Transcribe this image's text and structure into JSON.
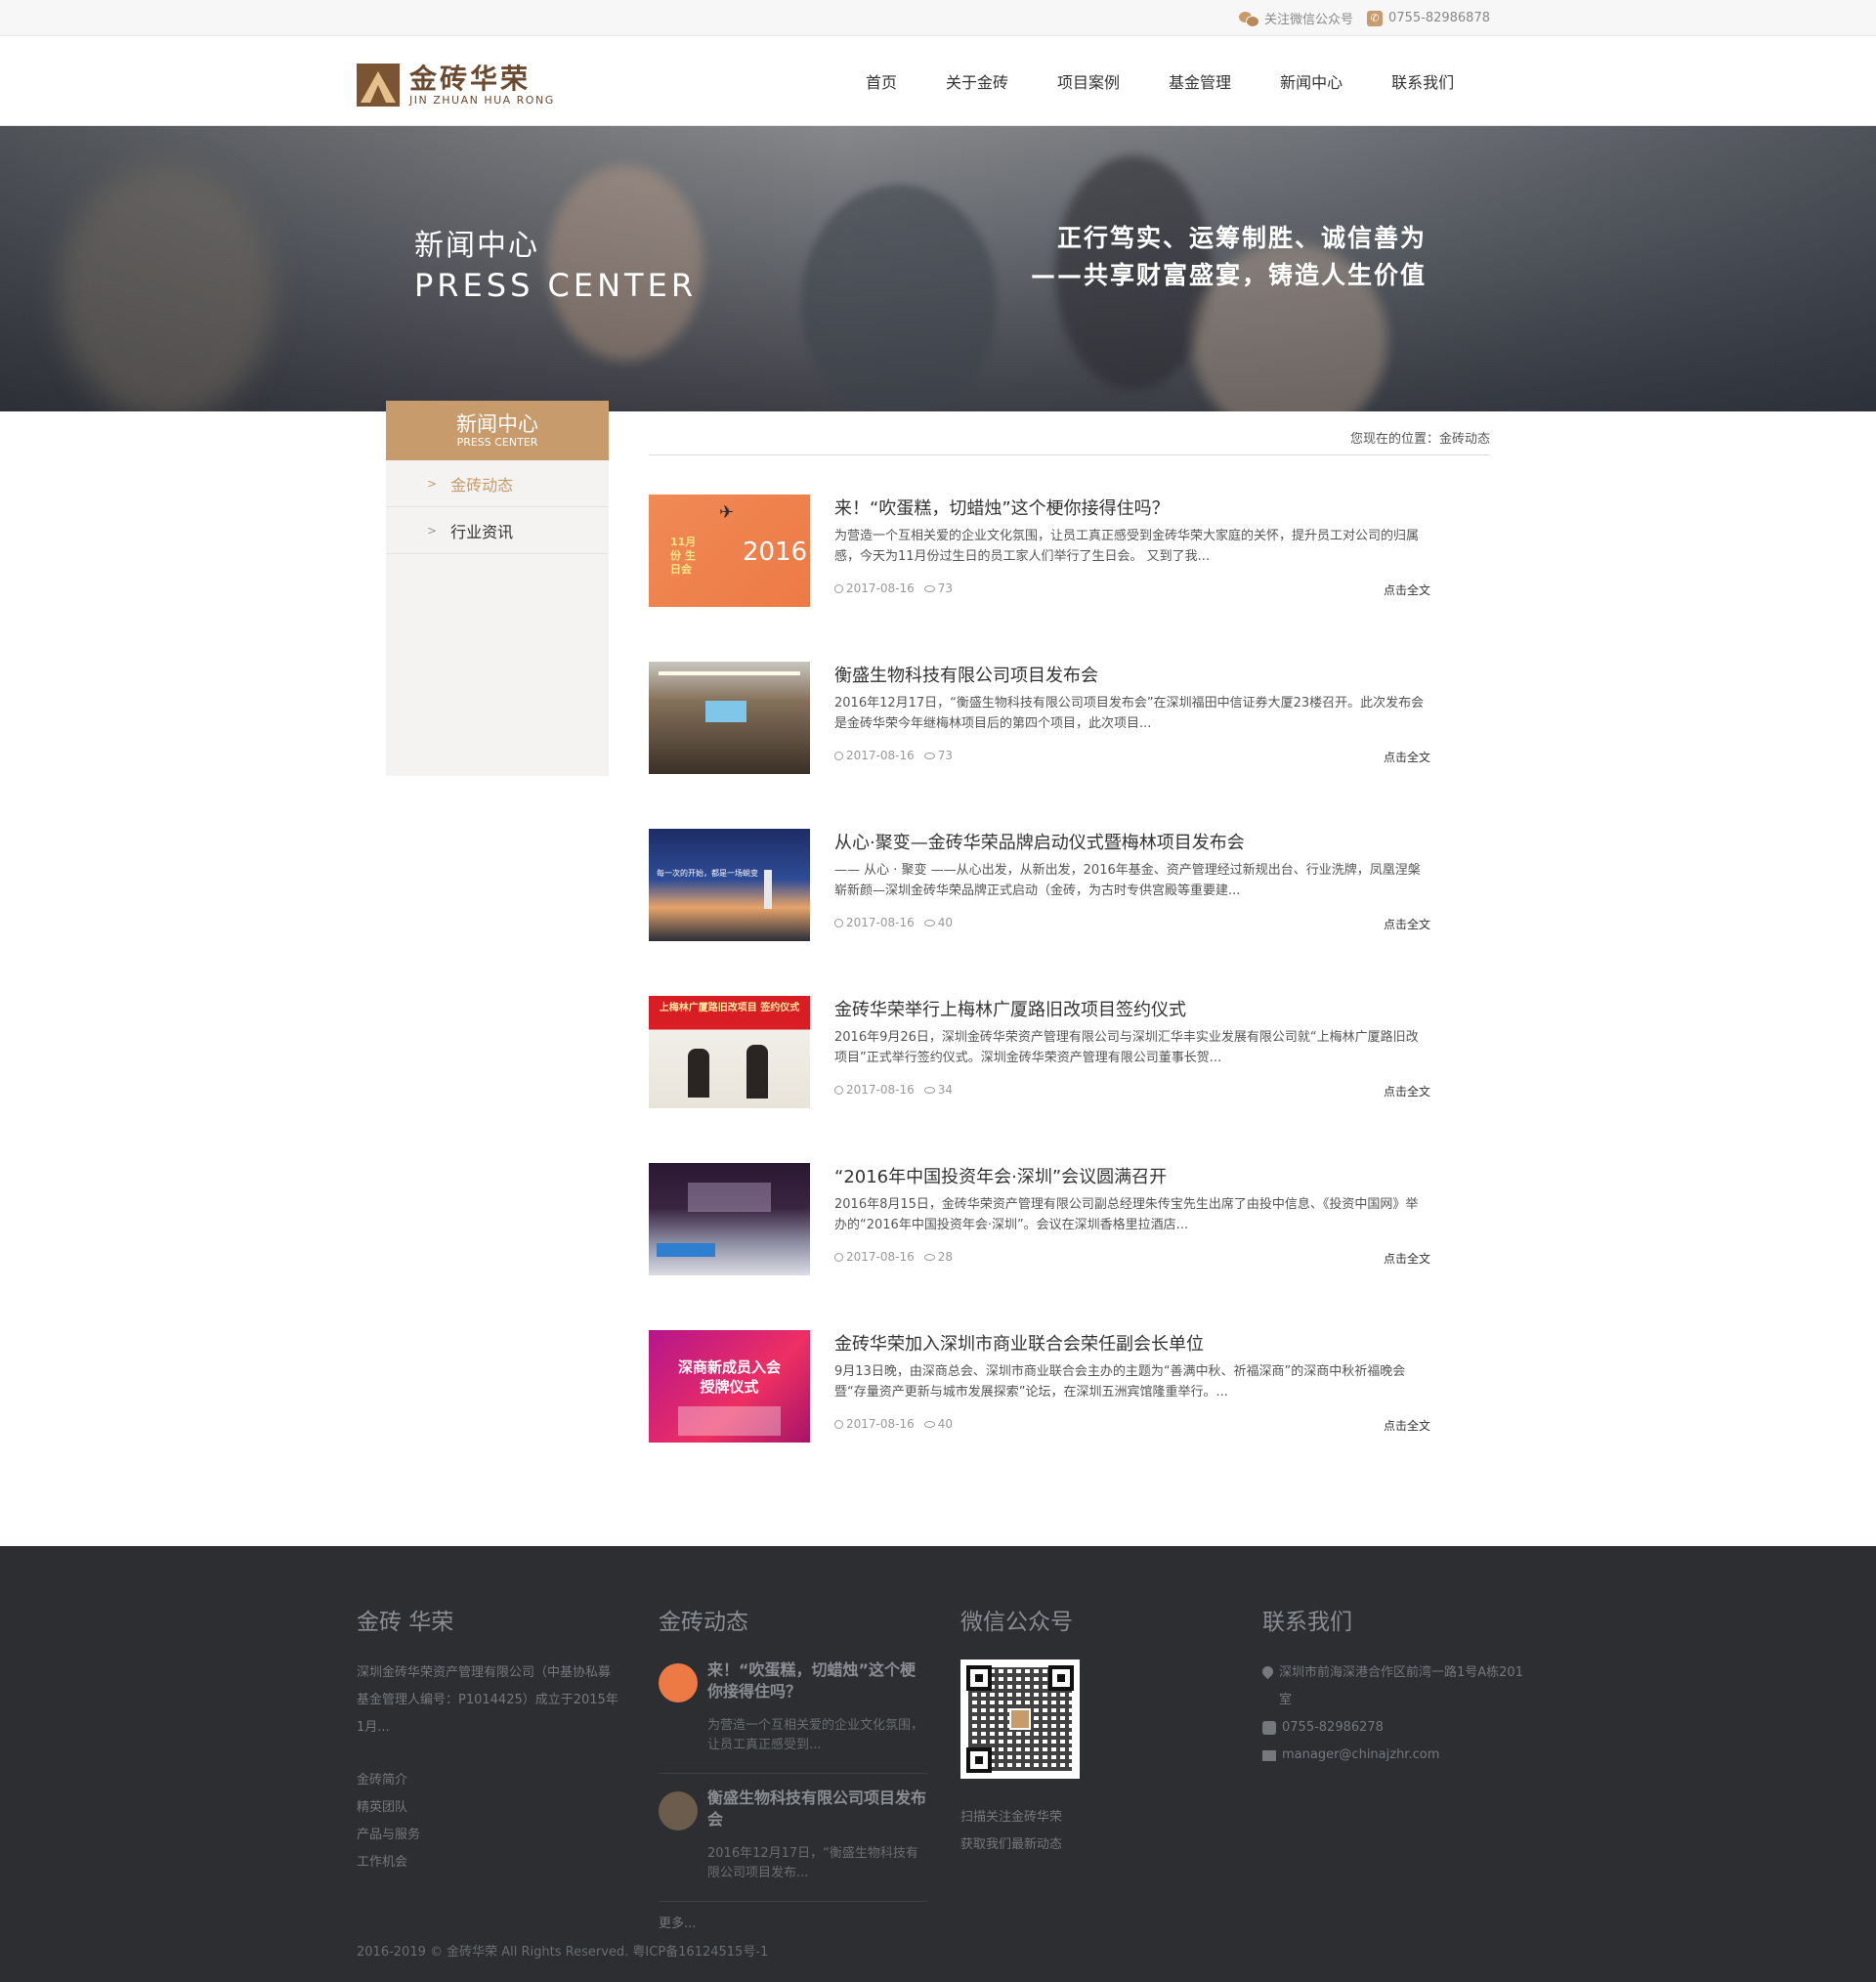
{
  "topbar": {
    "wechat_label": "关注微信公众号",
    "phone": "0755-82986878"
  },
  "logo": {
    "cn": "金砖华荣",
    "en": "JIN ZHUAN HUA RONG"
  },
  "nav": [
    "首页",
    "关于金砖",
    "项目案例",
    "基金管理",
    "新闻中心",
    "联系我们"
  ],
  "banner": {
    "title_cn": "新闻中心",
    "title_en": "PRESS CENTER",
    "slogan_1": "正行笃实、运筹制胜、诚信善为",
    "slogan_2": "——共享财富盛宴，铸造人生价值"
  },
  "sidebar": {
    "title_cn": "新闻中心",
    "title_en": "PRESS CENTER",
    "items": [
      {
        "label": "金砖动态",
        "active": true
      },
      {
        "label": "行业资讯",
        "active": false
      }
    ]
  },
  "breadcrumb": "您现在的位置：金砖动态",
  "news": [
    {
      "title": "来！“吹蛋糕，切蜡烛”这个梗你接得住吗？",
      "desc": "为营造一个互相关爱的企业文化氛围，让员工真正感受到金砖华荣大家庭的关怀，提升员工对公司的归属感，今天为11月份过生日的员工家人们举行了生日会。 又到了我...",
      "date": "2017-08-16",
      "views": "73",
      "more": "点击全文",
      "thumb_text": "2016",
      "thumb_text_2": "11月份 生日会"
    },
    {
      "title": "衡盛生物科技有限公司项目发布会",
      "desc": "2016年12月17日，“衡盛生物科技有限公司项目发布会”在深圳福田中信证券大厦23楼召开。此次发布会是金砖华荣今年继梅林项目后的第四个项目，此次项目...",
      "date": "2017-08-16",
      "views": "73",
      "more": "点击全文"
    },
    {
      "title": "从心·聚变—金砖华荣品牌启动仪式暨梅林项目发布会",
      "desc": "—— 从心 · 聚变 ——从心出发，从新出发，2016年基金、资产管理经过新规出台、行业洗牌，凤凰涅槃崭新颜—深圳金砖华荣品牌正式启动（金砖，为古时专供宫殿等重要建...",
      "date": "2017-08-16",
      "views": "40",
      "more": "点击全文",
      "thumb_text": "每一次的开始，都是一场蜕变"
    },
    {
      "title": "金砖华荣举行上梅林广厦路旧改项目签约仪式",
      "desc": "2016年9月26日，深圳金砖华荣资产管理有限公司与深圳汇华丰实业发展有限公司就“上梅林广厦路旧改项目”正式举行签约仪式。深圳金砖华荣资产管理有限公司董事长贺...",
      "date": "2017-08-16",
      "views": "34",
      "more": "点击全文",
      "thumb_text": "上梅林广厦路旧改项目 签约仪式"
    },
    {
      "title": "“2016年中国投资年会·深圳”会议圆满召开",
      "desc": "2016年8月15日，金砖华荣资产管理有限公司副总经理朱传宝先生出席了由投中信息、《投资中国网》举办的“2016年中国投资年会·深圳”。会议在深圳香格里拉酒店...",
      "date": "2017-08-16",
      "views": "28",
      "more": "点击全文"
    },
    {
      "title": "金砖华荣加入深圳市商业联合会荣任副会长单位",
      "desc": "9月13日晚，由深商总会、深圳市商业联合会主办的主题为“善满中秋、祈福深商”的深商中秋祈福晚会暨“存量资产更新与城市发展探索”论坛，在深圳五洲宾馆隆重举行。...",
      "date": "2017-08-16",
      "views": "40",
      "more": "点击全文",
      "thumb_text": "深商新成员入会 授牌仪式"
    }
  ],
  "footer": {
    "about": {
      "title": "金砖 华荣",
      "text": "深圳金砖华荣资产管理有限公司（中基协私募基金管理人编号：P1014425）成立于2015年1月...",
      "links": [
        "金砖简介",
        "精英团队",
        "产品与服务",
        "工作机会"
      ]
    },
    "news": {
      "title": "金砖动态",
      "items": [
        {
          "title": "来！“吹蛋糕，切蜡烛”这个梗你接得住吗？",
          "desc": "为营造一个互相关爱的企业文化氛围，让员工真正感受到..."
        },
        {
          "title": "衡盛生物科技有限公司项目发布会",
          "desc": "2016年12月17日，“衡盛生物科技有限公司项目发布..."
        }
      ],
      "more": "更多..."
    },
    "wechat": {
      "title": "微信公众号",
      "line1": "扫描关注金砖华荣",
      "line2": "获取我们最新动态"
    },
    "contact": {
      "title": "联系我们",
      "address": "深圳市前海深港合作区前湾一路1号A栋201室",
      "phone": "0755-82986278",
      "email": "manager@chinajzhr.com"
    },
    "copyright": "2016-2019 © 金砖华荣 All Rights Reserved. 粤ICP备16124515号-1"
  },
  "colors": {
    "accent": "#c89b6d",
    "footer_bg": "#2c2e31",
    "logo_brown": "#6b4a2f"
  }
}
